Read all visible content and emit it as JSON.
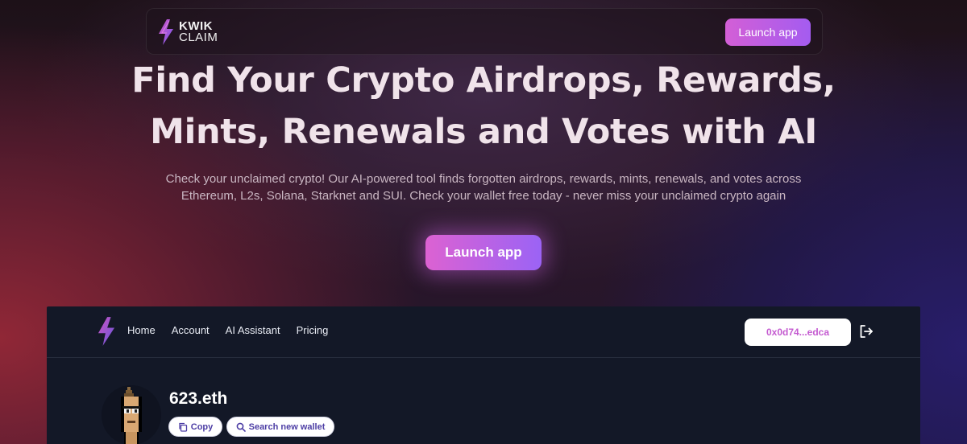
{
  "topnav": {
    "brand_line1": "KWIK",
    "brand_line2": "CLAIM",
    "launch_label": "Launch app"
  },
  "hero": {
    "title_line1": "Find Your Crypto Airdrops, Rewards,",
    "title_line2": "Mints, Renewals and Votes with AI",
    "subtitle_line1": "Check your unclaimed crypto! Our AI-powered tool finds forgotten airdrops, rewards, mints, renewals, and votes across",
    "subtitle_line2": "Ethereum, L2s, Solana, Starknet and SUI. Check your wallet free today - never miss your unclaimed crypto again",
    "launch_label": "Launch app"
  },
  "app_preview": {
    "nav": {
      "links": [
        "Home",
        "Account",
        "AI Assistant",
        "Pricing"
      ],
      "wallet_address": "0x0d74...edca"
    },
    "profile": {
      "name": "623.eth",
      "copy_label": "Copy",
      "search_label": "Search new wallet"
    }
  },
  "colors": {
    "accent_start": "#d35fd6",
    "accent_end": "#a45cf0",
    "app_bg": "#131827",
    "wallet_text": "#c45ad0"
  },
  "icons": [
    "bolt-logo-icon",
    "logout-icon",
    "copy-icon",
    "search-icon"
  ]
}
